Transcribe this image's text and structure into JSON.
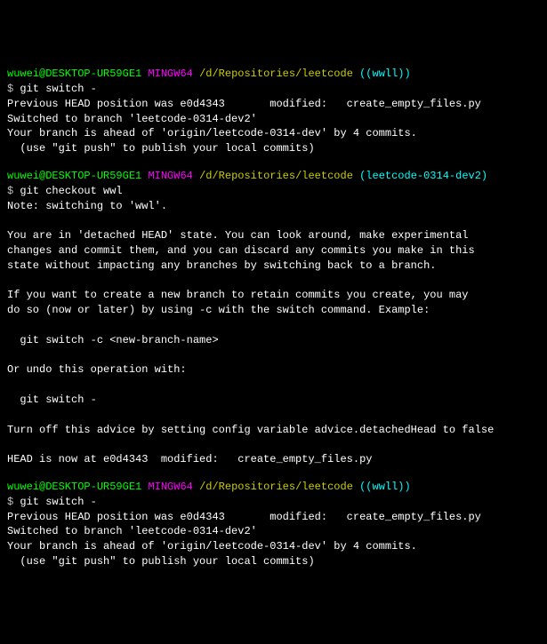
{
  "blocks": [
    {
      "prompt": {
        "user_host": "wuwei@DESKTOP-UR59GE1",
        "shell": "MINGW64",
        "path": "/d/Repositories/leetcode",
        "branch": "((wwll))"
      },
      "command_symbol": "$ ",
      "command": "git switch -",
      "output": [
        "Previous HEAD position was e0d4343       modified:   create_empty_files.py",
        "Switched to branch 'leetcode-0314-dev2'",
        "Your branch is ahead of 'origin/leetcode-0314-dev' by 4 commits.",
        "  (use \"git push\" to publish your local commits)"
      ]
    },
    {
      "prompt": {
        "user_host": "wuwei@DESKTOP-UR59GE1",
        "shell": "MINGW64",
        "path": "/d/Repositories/leetcode",
        "branch": "(leetcode-0314-dev2)"
      },
      "command_symbol": "$ ",
      "command": "git checkout wwl",
      "output": [
        "Note: switching to 'wwl'.",
        "",
        "You are in 'detached HEAD' state. You can look around, make experimental",
        "changes and commit them, and you can discard any commits you make in this",
        "state without impacting any branches by switching back to a branch.",
        "",
        "If you want to create a new branch to retain commits you create, you may",
        "do so (now or later) by using -c with the switch command. Example:",
        "",
        "  git switch -c <new-branch-name>",
        "",
        "Or undo this operation with:",
        "",
        "  git switch -",
        "",
        "Turn off this advice by setting config variable advice.detachedHead to false",
        "",
        "HEAD is now at e0d4343  modified:   create_empty_files.py"
      ]
    },
    {
      "prompt": {
        "user_host": "wuwei@DESKTOP-UR59GE1",
        "shell": "MINGW64",
        "path": "/d/Repositories/leetcode",
        "branch": "((wwll))"
      },
      "command_symbol": "$ ",
      "command": "git switch -",
      "output": [
        "Previous HEAD position was e0d4343       modified:   create_empty_files.py",
        "Switched to branch 'leetcode-0314-dev2'",
        "Your branch is ahead of 'origin/leetcode-0314-dev' by 4 commits.",
        "  (use \"git push\" to publish your local commits)"
      ]
    }
  ]
}
